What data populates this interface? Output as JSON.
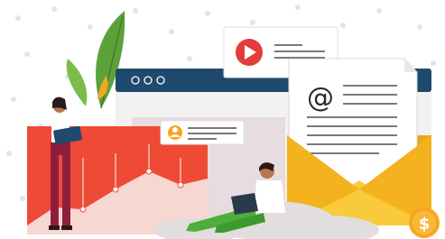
{
  "illustration": {
    "palette": {
      "background": "#ffffff",
      "dots": "#d6e6f5",
      "browser_bar": "#1f4a6e",
      "browser_body": "#f3f1f1",
      "browser_panel": "#e7dcdf",
      "chart_red": "#ee4a35",
      "chart_mountain": "#f7d7d2",
      "envelope": "#f6bf2a",
      "envelope_dark": "#e5a91c",
      "letter": "#ffffff",
      "line": "#2b2b2b",
      "play_red": "#e63b3b",
      "avatar_orange": "#f5a623",
      "leaf_green": "#5da13b",
      "person_skin": "#b8744e",
      "pants_maroon": "#8f1e3d",
      "pants_green": "#4fae3b",
      "shirt_white": "#ffffff",
      "hair_dark": "#2a1a1a",
      "laptop": "#2b3a4a",
      "coin": "#f5a623",
      "cloud": "#e3dede"
    },
    "icons": {
      "play": "play-icon",
      "at": "at-sign-icon",
      "user": "user-avatar-icon",
      "dollar": "dollar-coin-icon",
      "window_dots": "window-controls-icon"
    },
    "coin_symbol": "$",
    "at_symbol": "@"
  }
}
